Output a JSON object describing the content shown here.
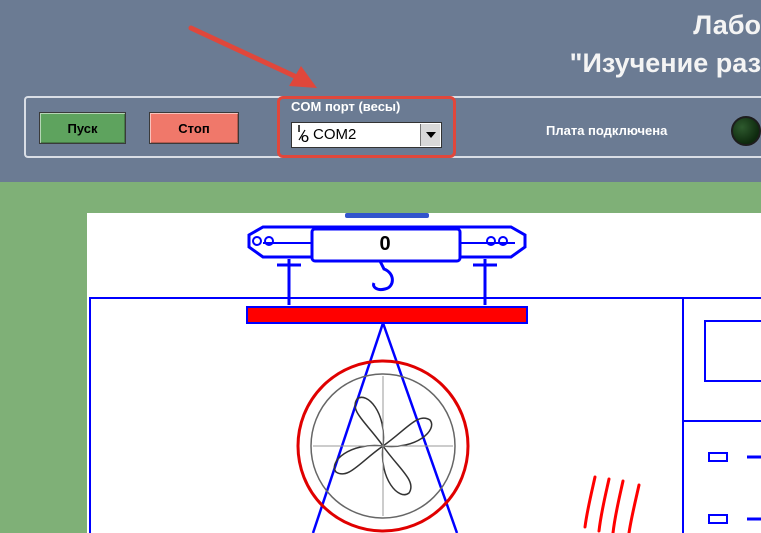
{
  "title": {
    "line1": "Лабо",
    "line2": "\"Изучение раз"
  },
  "toolbar": {
    "start_label": "Пуск",
    "stop_label": "Стоп"
  },
  "com_port": {
    "label": "COM порт (весы)",
    "value": "COM2"
  },
  "board_status": {
    "label": "Плата подключена",
    "connected": false
  },
  "scale": {
    "reading": "0"
  },
  "colors": {
    "header_bg": "#6b7b93",
    "start_button": "#5ea35e",
    "stop_button": "#f0786a",
    "highlight": "#e0473b",
    "diagram_blue": "#0000ff",
    "diagram_red": "#ff0000",
    "background_green": "#7fb077"
  }
}
